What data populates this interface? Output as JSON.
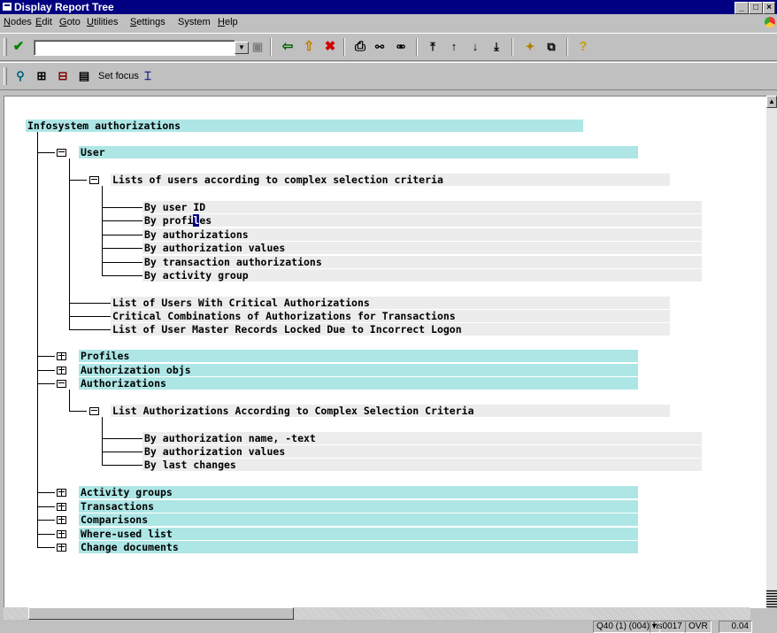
{
  "window": {
    "title": "Display Report Tree"
  },
  "menu": [
    {
      "label": "Nodes",
      "ul": "N",
      "rest": "odes"
    },
    {
      "label": "Edit",
      "ul": "E",
      "rest": "dit"
    },
    {
      "label": "Goto",
      "ul": "G",
      "rest": "oto"
    },
    {
      "label": "Utilities",
      "ul": "U",
      "rest": "tilities"
    },
    {
      "label": "Settings",
      "ul": "S",
      "rest": "ettings"
    },
    {
      "label": "System",
      "ul": "",
      "rest": "System"
    },
    {
      "label": "Help",
      "ul": "H",
      "rest": "elp"
    }
  ],
  "toolbar2": {
    "set_focus_label": "Set focus"
  },
  "tree": {
    "root": "Infosystem authorizations",
    "user": "User",
    "lists_complex": "Lists of users according to complex selection criteria",
    "by_user_id": "By user ID",
    "by_profiles_a": "By profi",
    "by_profiles_cursor": "l",
    "by_profiles_b": "es",
    "by_authorizations": "By authorizations",
    "by_authorization_values": "By authorization values",
    "by_transaction_authorizations": "By transaction authorizations",
    "by_activity_group": "By activity group",
    "critical_auth": "List of Users With Critical Authorizations",
    "critical_combinations": "Critical Combinations of Authorizations for Transactions",
    "locked_users": "List of User Master Records Locked Due to Incorrect Logon",
    "profiles": "Profiles",
    "authorization_objs": "Authorization objs",
    "authorizations": "Authorizations",
    "list_auth_complex": "List Authorizations According to Complex Selection Criteria",
    "by_auth_name": "By authorization name, -text",
    "by_auth_values": "By authorization values",
    "by_last_changes": "By last changes",
    "activity_groups": "Activity groups",
    "transactions": "Transactions",
    "comparisons": "Comparisons",
    "where_used": "Where-used list",
    "change_documents": "Change documents"
  },
  "status": {
    "system": "Q40 (1) (004)",
    "server": "hs0017",
    "mode": "OVR",
    "time": "0.04"
  }
}
